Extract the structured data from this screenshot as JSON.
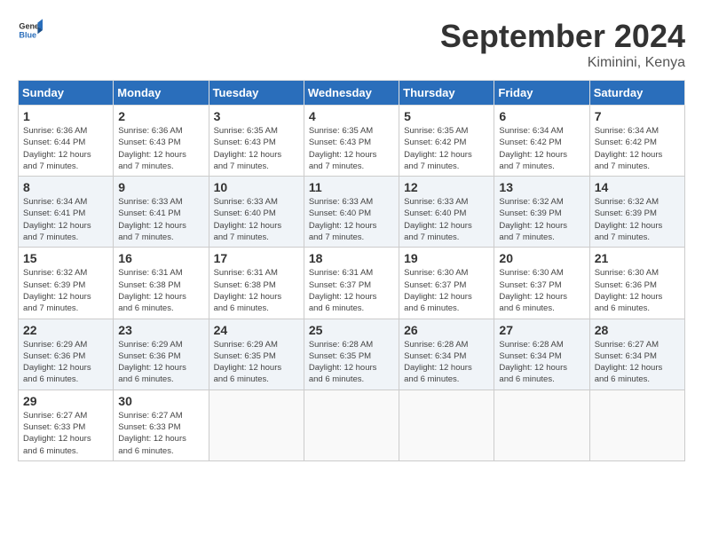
{
  "header": {
    "logo_line1": "General",
    "logo_line2": "Blue",
    "month": "September 2024",
    "location": "Kiminini, Kenya"
  },
  "days_of_week": [
    "Sunday",
    "Monday",
    "Tuesday",
    "Wednesday",
    "Thursday",
    "Friday",
    "Saturday"
  ],
  "weeks": [
    [
      {
        "num": "1",
        "info": "Sunrise: 6:36 AM\nSunset: 6:44 PM\nDaylight: 12 hours\nand 7 minutes."
      },
      {
        "num": "2",
        "info": "Sunrise: 6:36 AM\nSunset: 6:43 PM\nDaylight: 12 hours\nand 7 minutes."
      },
      {
        "num": "3",
        "info": "Sunrise: 6:35 AM\nSunset: 6:43 PM\nDaylight: 12 hours\nand 7 minutes."
      },
      {
        "num": "4",
        "info": "Sunrise: 6:35 AM\nSunset: 6:43 PM\nDaylight: 12 hours\nand 7 minutes."
      },
      {
        "num": "5",
        "info": "Sunrise: 6:35 AM\nSunset: 6:42 PM\nDaylight: 12 hours\nand 7 minutes."
      },
      {
        "num": "6",
        "info": "Sunrise: 6:34 AM\nSunset: 6:42 PM\nDaylight: 12 hours\nand 7 minutes."
      },
      {
        "num": "7",
        "info": "Sunrise: 6:34 AM\nSunset: 6:42 PM\nDaylight: 12 hours\nand 7 minutes."
      }
    ],
    [
      {
        "num": "8",
        "info": "Sunrise: 6:34 AM\nSunset: 6:41 PM\nDaylight: 12 hours\nand 7 minutes."
      },
      {
        "num": "9",
        "info": "Sunrise: 6:33 AM\nSunset: 6:41 PM\nDaylight: 12 hours\nand 7 minutes."
      },
      {
        "num": "10",
        "info": "Sunrise: 6:33 AM\nSunset: 6:40 PM\nDaylight: 12 hours\nand 7 minutes."
      },
      {
        "num": "11",
        "info": "Sunrise: 6:33 AM\nSunset: 6:40 PM\nDaylight: 12 hours\nand 7 minutes."
      },
      {
        "num": "12",
        "info": "Sunrise: 6:33 AM\nSunset: 6:40 PM\nDaylight: 12 hours\nand 7 minutes."
      },
      {
        "num": "13",
        "info": "Sunrise: 6:32 AM\nSunset: 6:39 PM\nDaylight: 12 hours\nand 7 minutes."
      },
      {
        "num": "14",
        "info": "Sunrise: 6:32 AM\nSunset: 6:39 PM\nDaylight: 12 hours\nand 7 minutes."
      }
    ],
    [
      {
        "num": "15",
        "info": "Sunrise: 6:32 AM\nSunset: 6:39 PM\nDaylight: 12 hours\nand 7 minutes."
      },
      {
        "num": "16",
        "info": "Sunrise: 6:31 AM\nSunset: 6:38 PM\nDaylight: 12 hours\nand 6 minutes."
      },
      {
        "num": "17",
        "info": "Sunrise: 6:31 AM\nSunset: 6:38 PM\nDaylight: 12 hours\nand 6 minutes."
      },
      {
        "num": "18",
        "info": "Sunrise: 6:31 AM\nSunset: 6:37 PM\nDaylight: 12 hours\nand 6 minutes."
      },
      {
        "num": "19",
        "info": "Sunrise: 6:30 AM\nSunset: 6:37 PM\nDaylight: 12 hours\nand 6 minutes."
      },
      {
        "num": "20",
        "info": "Sunrise: 6:30 AM\nSunset: 6:37 PM\nDaylight: 12 hours\nand 6 minutes."
      },
      {
        "num": "21",
        "info": "Sunrise: 6:30 AM\nSunset: 6:36 PM\nDaylight: 12 hours\nand 6 minutes."
      }
    ],
    [
      {
        "num": "22",
        "info": "Sunrise: 6:29 AM\nSunset: 6:36 PM\nDaylight: 12 hours\nand 6 minutes."
      },
      {
        "num": "23",
        "info": "Sunrise: 6:29 AM\nSunset: 6:36 PM\nDaylight: 12 hours\nand 6 minutes."
      },
      {
        "num": "24",
        "info": "Sunrise: 6:29 AM\nSunset: 6:35 PM\nDaylight: 12 hours\nand 6 minutes."
      },
      {
        "num": "25",
        "info": "Sunrise: 6:28 AM\nSunset: 6:35 PM\nDaylight: 12 hours\nand 6 minutes."
      },
      {
        "num": "26",
        "info": "Sunrise: 6:28 AM\nSunset: 6:34 PM\nDaylight: 12 hours\nand 6 minutes."
      },
      {
        "num": "27",
        "info": "Sunrise: 6:28 AM\nSunset: 6:34 PM\nDaylight: 12 hours\nand 6 minutes."
      },
      {
        "num": "28",
        "info": "Sunrise: 6:27 AM\nSunset: 6:34 PM\nDaylight: 12 hours\nand 6 minutes."
      }
    ],
    [
      {
        "num": "29",
        "info": "Sunrise: 6:27 AM\nSunset: 6:33 PM\nDaylight: 12 hours\nand 6 minutes."
      },
      {
        "num": "30",
        "info": "Sunrise: 6:27 AM\nSunset: 6:33 PM\nDaylight: 12 hours\nand 6 minutes."
      },
      {
        "num": "",
        "info": ""
      },
      {
        "num": "",
        "info": ""
      },
      {
        "num": "",
        "info": ""
      },
      {
        "num": "",
        "info": ""
      },
      {
        "num": "",
        "info": ""
      }
    ]
  ]
}
